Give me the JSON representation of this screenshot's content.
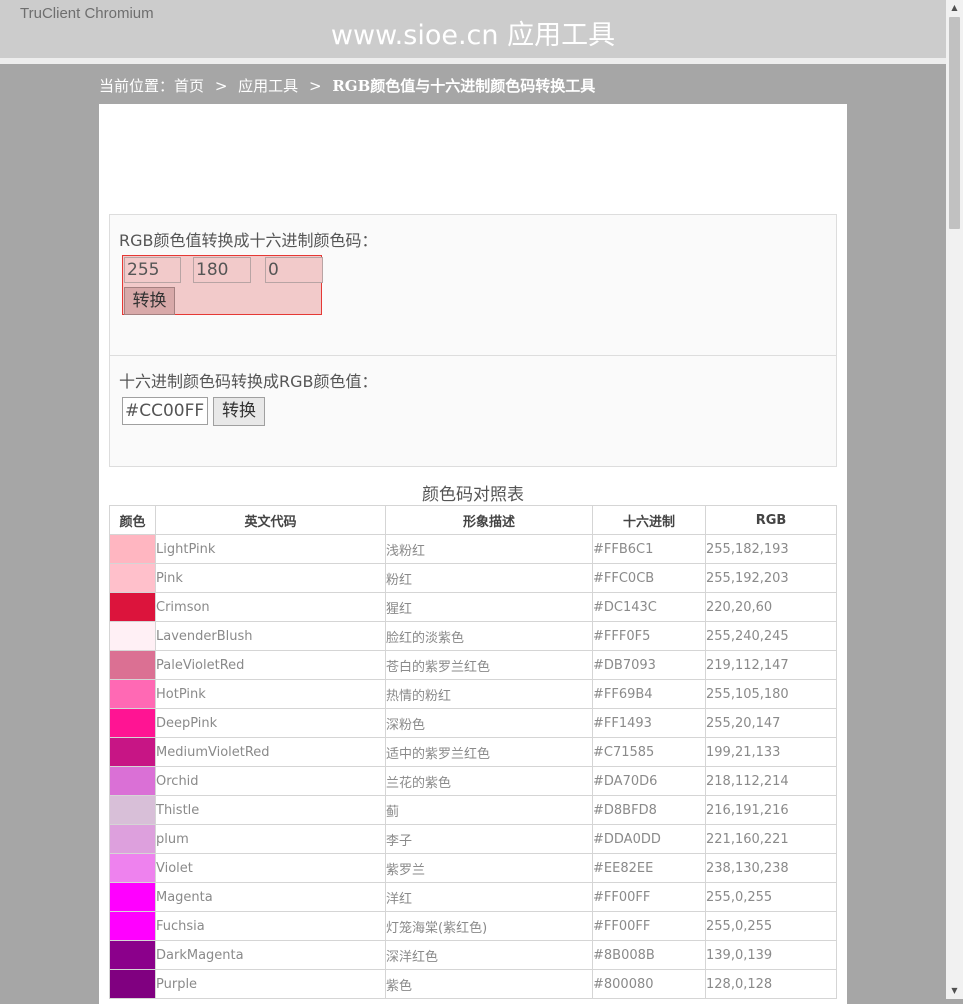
{
  "browser": {
    "app_name": "TruClient Chromium"
  },
  "header": {
    "site_title": "www.sioe.cn 应用工具"
  },
  "breadcrumb": {
    "prefix": "当前位置：",
    "home": "首页",
    "sep": ">",
    "tools": "应用工具",
    "current": "RGB颜色值与十六进制颜色码转换工具"
  },
  "rgb_to_hex": {
    "title": "RGB颜色值转换成十六进制颜色码：",
    "r": "255",
    "g": "180",
    "b": "0",
    "button": "转换"
  },
  "hex_to_rgb": {
    "title": "十六进制颜色码转换成RGB颜色值：",
    "hex": "#CC00FF",
    "button": "转换"
  },
  "table": {
    "caption": "颜色码对照表",
    "headers": [
      "颜色",
      "英文代码",
      "形象描述",
      "十六进制",
      "RGB"
    ],
    "rows": [
      {
        "swatch": "#FFB6C1",
        "name": "LightPink",
        "desc": "浅粉红",
        "hex": "#FFB6C1",
        "rgb": "255,182,193"
      },
      {
        "swatch": "#FFC0CB",
        "name": "Pink",
        "desc": "粉红",
        "hex": "#FFC0CB",
        "rgb": "255,192,203"
      },
      {
        "swatch": "#DC143C",
        "name": "Crimson",
        "desc": "猩红",
        "hex": "#DC143C",
        "rgb": "220,20,60"
      },
      {
        "swatch": "#FFF0F5",
        "name": "LavenderBlush",
        "desc": "脸红的淡紫色",
        "hex": "#FFF0F5",
        "rgb": "255,240,245"
      },
      {
        "swatch": "#DB7093",
        "name": "PaleVioletRed",
        "desc": "苍白的紫罗兰红色",
        "hex": "#DB7093",
        "rgb": "219,112,147"
      },
      {
        "swatch": "#FF69B4",
        "name": "HotPink",
        "desc": "热情的粉红",
        "hex": "#FF69B4",
        "rgb": "255,105,180"
      },
      {
        "swatch": "#FF1493",
        "name": "DeepPink",
        "desc": "深粉色",
        "hex": "#FF1493",
        "rgb": "255,20,147"
      },
      {
        "swatch": "#C71585",
        "name": "MediumVioletRed",
        "desc": "适中的紫罗兰红色",
        "hex": "#C71585",
        "rgb": "199,21,133"
      },
      {
        "swatch": "#DA70D6",
        "name": "Orchid",
        "desc": "兰花的紫色",
        "hex": "#DA70D6",
        "rgb": "218,112,214"
      },
      {
        "swatch": "#D8BFD8",
        "name": "Thistle",
        "desc": "蓟",
        "hex": "#D8BFD8",
        "rgb": "216,191,216"
      },
      {
        "swatch": "#DDA0DD",
        "name": "plum",
        "desc": "李子",
        "hex": "#DDA0DD",
        "rgb": "221,160,221"
      },
      {
        "swatch": "#EE82EE",
        "name": "Violet",
        "desc": "紫罗兰",
        "hex": "#EE82EE",
        "rgb": "238,130,238"
      },
      {
        "swatch": "#FF00FF",
        "name": "Magenta",
        "desc": "洋红",
        "hex": "#FF00FF",
        "rgb": "255,0,255"
      },
      {
        "swatch": "#FF00FF",
        "name": "Fuchsia",
        "desc": "灯笼海棠(紫红色)",
        "hex": "#FF00FF",
        "rgb": "255,0,255"
      },
      {
        "swatch": "#8B008B",
        "name": "DarkMagenta",
        "desc": "深洋红色",
        "hex": "#8B008B",
        "rgb": "139,0,139"
      },
      {
        "swatch": "#800080",
        "name": "Purple",
        "desc": "紫色",
        "hex": "#800080",
        "rgb": "128,0,128"
      }
    ]
  },
  "scrollbar": {
    "up_icon": "▲",
    "down_icon": "▼"
  }
}
